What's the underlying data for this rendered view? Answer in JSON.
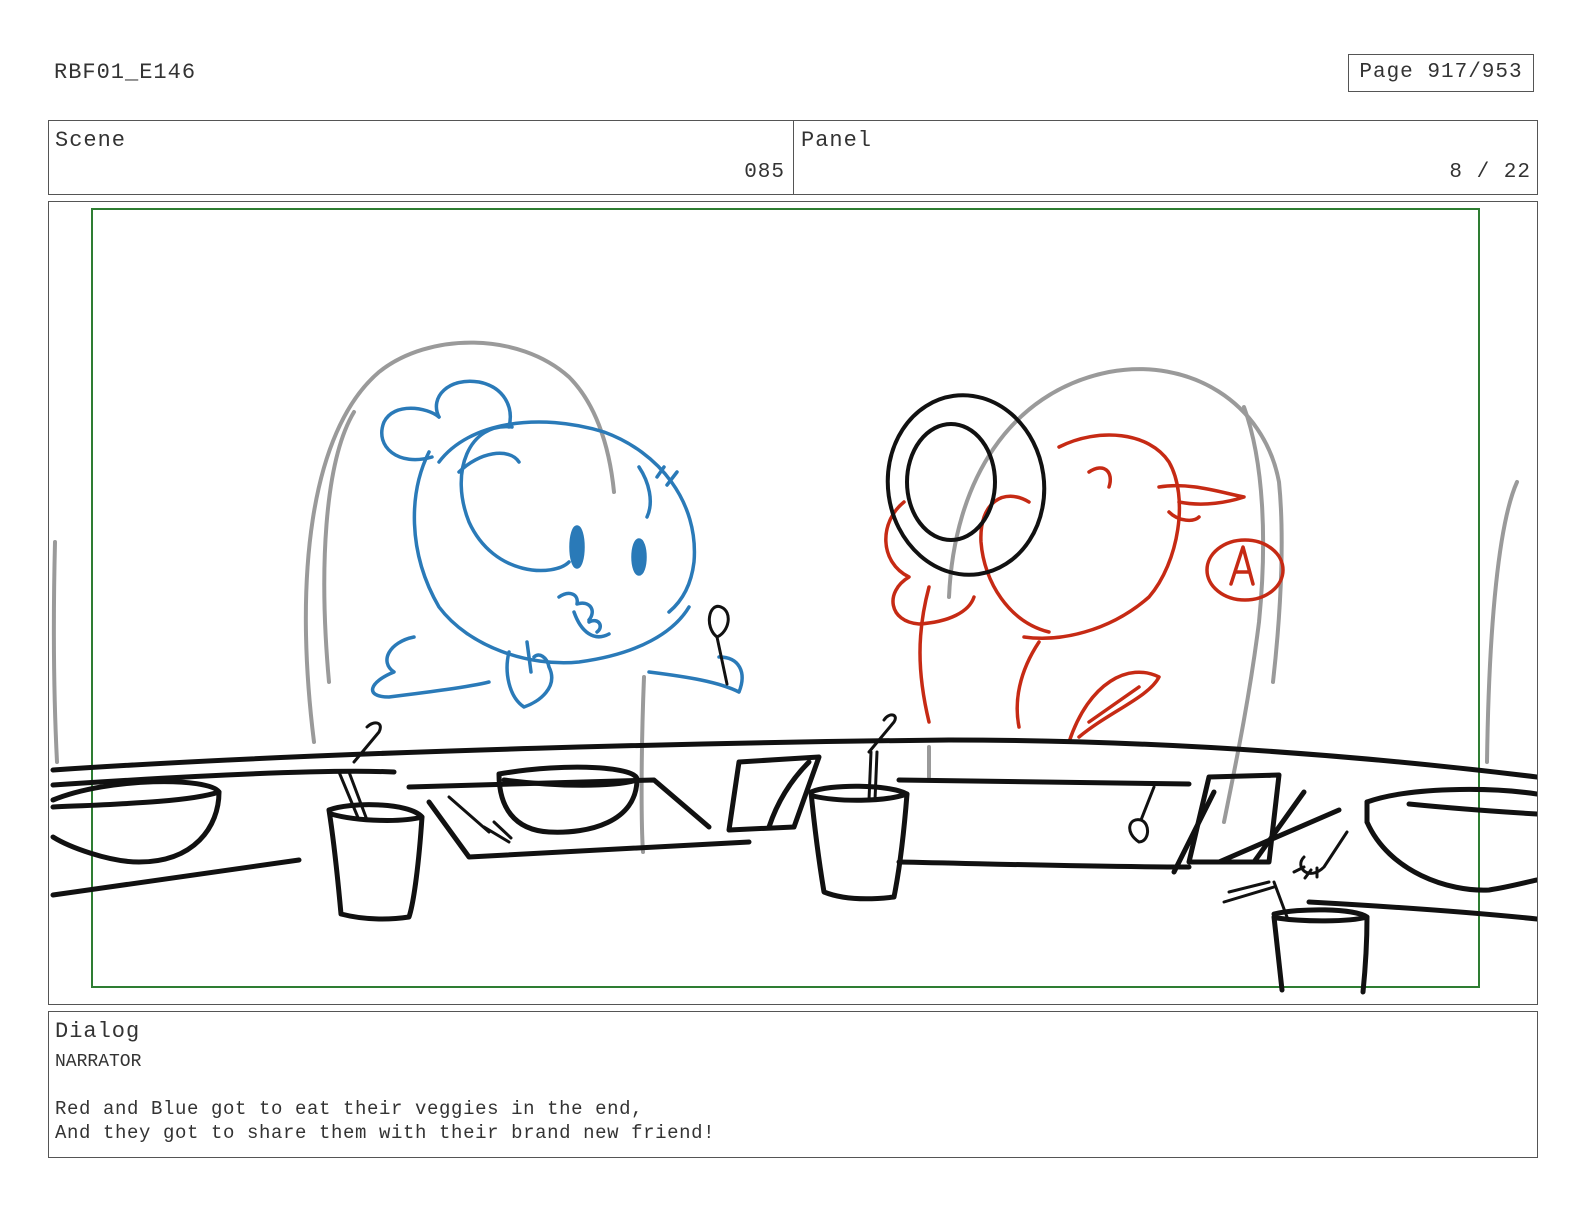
{
  "header": {
    "episode": "RBF01_E146",
    "page": "Page 917/953"
  },
  "info": {
    "scene_label": "Scene",
    "scene_value": "085",
    "panel_label": "Panel",
    "panel_value": "8 / 22"
  },
  "panel_art": {
    "badge_letter": "A",
    "colors": {
      "safe_area": "#2e7d32",
      "blue_character": "#2a7ab8",
      "red_character": "#c62a14",
      "ink": "#111111",
      "chair_outline": "#9a9a9a"
    }
  },
  "dialog": {
    "label": "Dialog",
    "speaker": "NARRATOR",
    "lines": [
      "Red and Blue got to eat their veggies in the end,",
      "And they got to share them with their brand new friend!"
    ]
  }
}
